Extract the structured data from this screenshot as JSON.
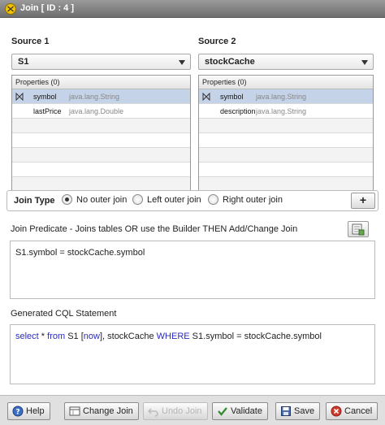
{
  "window": {
    "title": "Join [ ID : 4 ]",
    "icon": "join-icon"
  },
  "source1": {
    "label": "Source 1",
    "selected": "S1",
    "grid_header": "Properties (0)",
    "rows": [
      {
        "name": "symbol",
        "type": "java.lang.String",
        "selected": true
      },
      {
        "name": "lastPrice",
        "type": "java.lang.Double",
        "selected": false
      }
    ]
  },
  "source2": {
    "label": "Source 2",
    "selected": "stockCache",
    "grid_header": "Properties (0)",
    "rows": [
      {
        "name": "symbol",
        "type": "java.lang.String",
        "selected": true
      },
      {
        "name": "description",
        "type": "java.lang.String",
        "selected": false
      }
    ]
  },
  "join_type": {
    "label": "Join Type",
    "options": [
      "No outer join",
      "Left outer join",
      "Right outer join"
    ],
    "selected": "No outer join",
    "add_button": "+"
  },
  "predicate": {
    "label": "Join Predicate - Joins tables OR use the Builder THEN Add/Change Join",
    "value": "S1.symbol  =  stockCache.symbol"
  },
  "cql": {
    "label": "Generated CQL Statement",
    "parts": {
      "select": "select",
      "star": " * ",
      "from": "from",
      "s1": "  S1  [",
      "now": "now",
      "rest": "],  stockCache ",
      "where": "WHERE",
      "cond": " S1.symbol  =  stockCache.symbol"
    }
  },
  "footer": {
    "help": "Help",
    "change_join": "Change Join",
    "undo_join": "Undo Join",
    "validate": "Validate",
    "save": "Save",
    "cancel": "Cancel"
  },
  "colors": {
    "selected_row": "#c5d3e8",
    "keyword": "#2929c6",
    "titlebar": "#7a7a7a"
  }
}
